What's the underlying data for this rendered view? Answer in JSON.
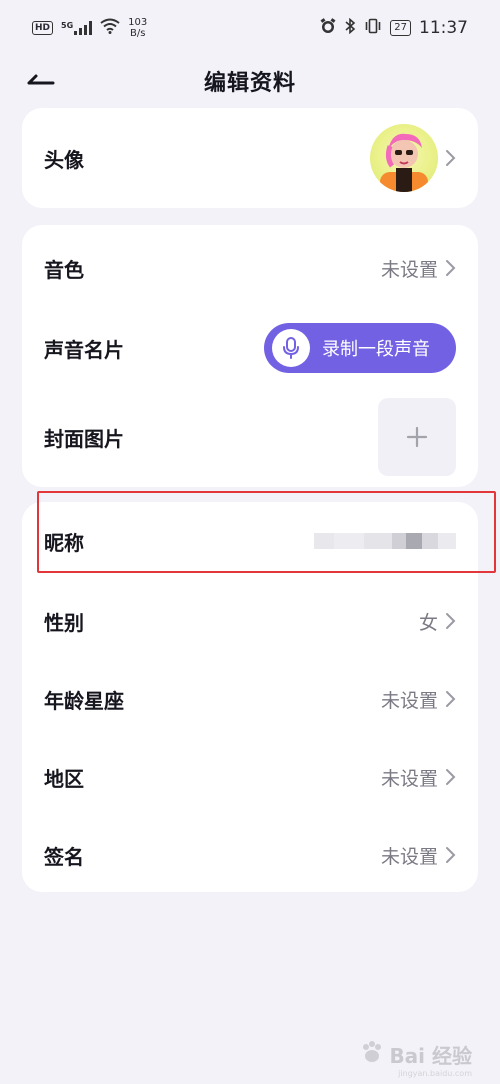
{
  "status_bar": {
    "hd": "HD",
    "signal": "5G",
    "net_speed_value": "103",
    "net_speed_unit": "B/s",
    "battery": "27",
    "time": "11:37"
  },
  "header": {
    "title": "编辑资料"
  },
  "profile": {
    "avatar_label": "头像"
  },
  "voice": {
    "timbre_label": "音色",
    "timbre_value": "未设置",
    "voice_card_label": "声音名片",
    "record_button_label": "录制一段声音",
    "cover_label": "封面图片"
  },
  "info": {
    "nickname_label": "昵称",
    "gender_label": "性别",
    "gender_value": "女",
    "age_zodiac_label": "年龄星座",
    "age_zodiac_value": "未设置",
    "region_label": "地区",
    "region_value": "未设置",
    "signature_label": "签名",
    "signature_value": "未设置"
  },
  "watermark": {
    "text": "Bai 经验",
    "sub": "jingyan.baidu.com"
  },
  "colors": {
    "background": "#f3f2f8",
    "card": "#ffffff",
    "accent": "#7361e4",
    "highlight": "#e2363b"
  }
}
